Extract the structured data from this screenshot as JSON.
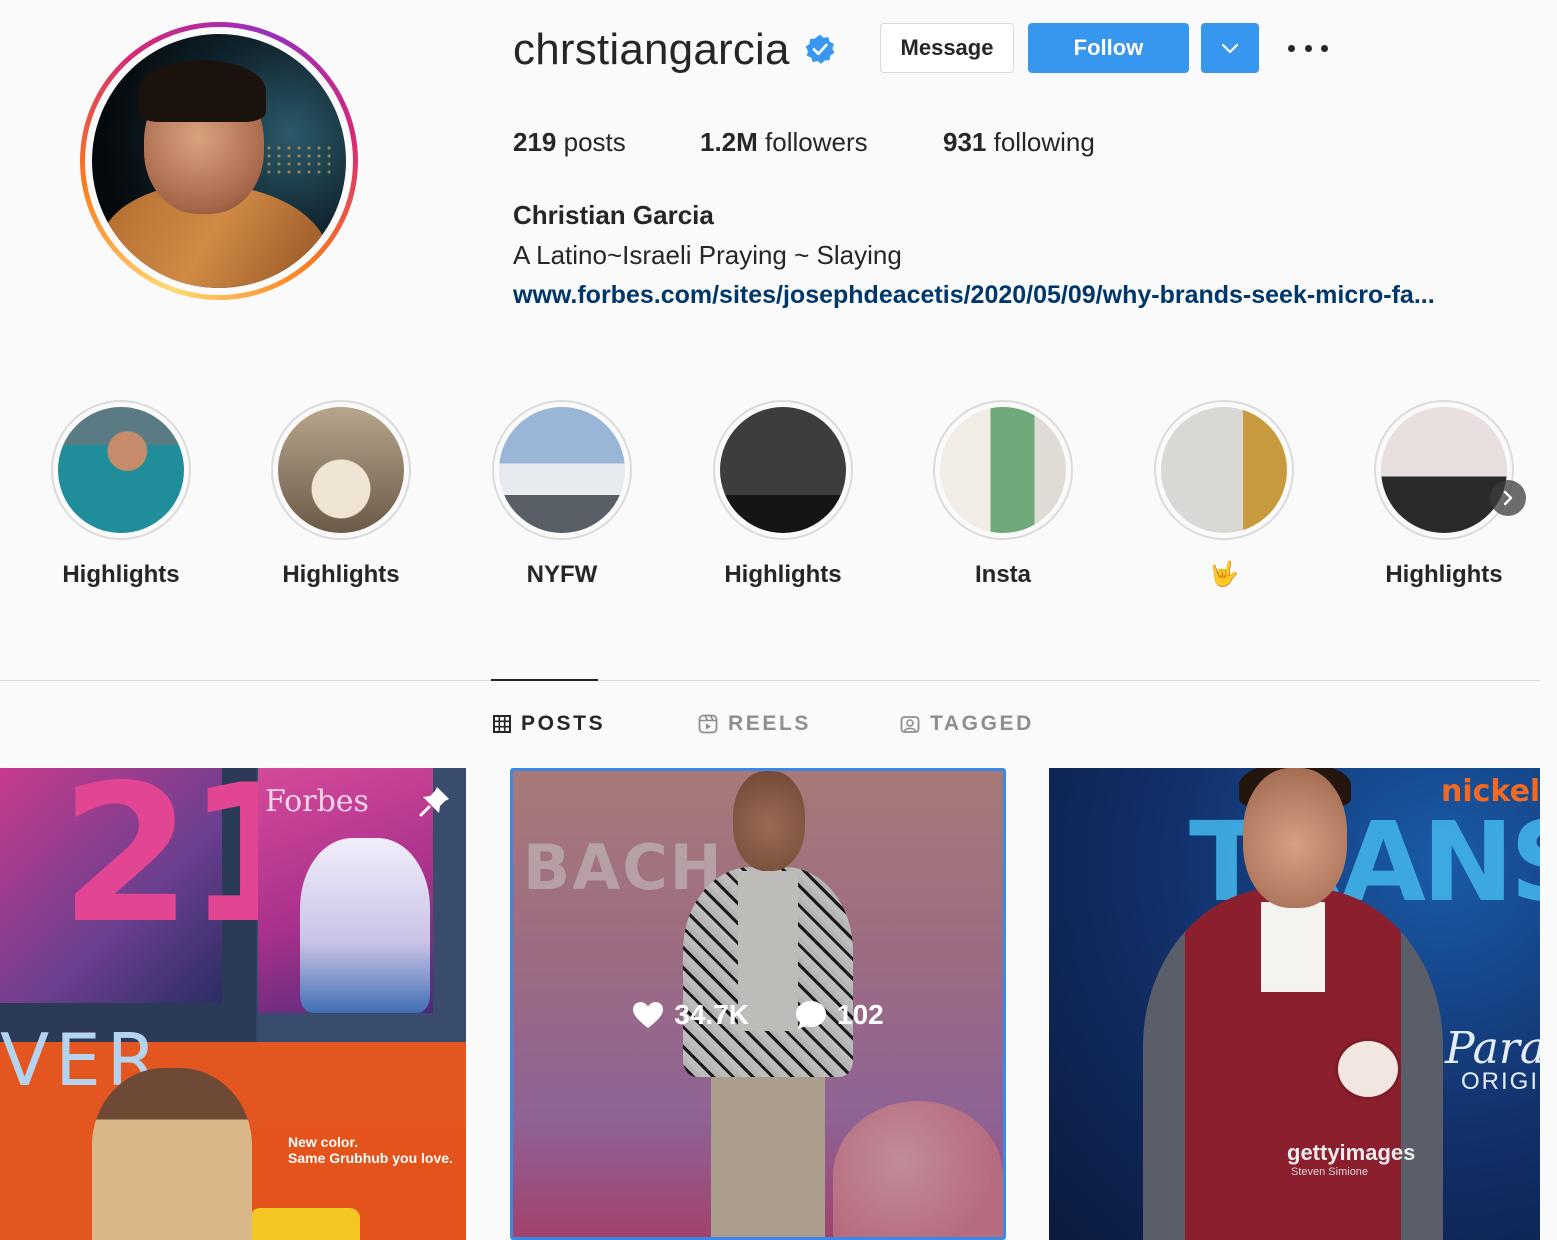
{
  "profile": {
    "username": "chrstiangarcia",
    "verified": true,
    "message_label": "Message",
    "follow_label": "Follow",
    "full_name": "Christian Garcia",
    "bio": "A Latino~Israeli Praying ~ Slaying",
    "link": "www.forbes.com/sites/josephdeacetis/2020/05/09/why-brands-seek-micro-fa..."
  },
  "stats": {
    "posts_count": "219",
    "posts_label": "posts",
    "followers_count": "1.2M",
    "followers_label": "followers",
    "following_count": "931",
    "following_label": "following"
  },
  "highlights": [
    {
      "label": "Highlights"
    },
    {
      "label": "Highlights"
    },
    {
      "label": "NYFW"
    },
    {
      "label": "Highlights"
    },
    {
      "label": "Insta"
    },
    {
      "label": "🤟"
    },
    {
      "label": "Highlights"
    }
  ],
  "tabs": [
    {
      "label": "POSTS",
      "icon": "grid-icon",
      "active": true
    },
    {
      "label": "REELS",
      "icon": "reels-icon",
      "active": false
    },
    {
      "label": "TAGGED",
      "icon": "tagged-icon",
      "active": false
    }
  ],
  "posts": [
    {
      "pinned": true,
      "text": {
        "forbes": "Forbes",
        "bus": "New color.\nSame Grubhub you love."
      }
    },
    {
      "hovered": true,
      "likes": "34.7K",
      "comments": "102",
      "text": {
        "backdrop": "BACH  R"
      }
    },
    {
      "text": {
        "brand": "nickel",
        "title": "TRANSF",
        "paramount": "Param",
        "original": "ORIGI",
        "watermark": "gettyimages",
        "credit": "Steven Simione"
      }
    }
  ],
  "colors": {
    "accent": "#3797ef",
    "link": "#00376b",
    "text": "#262626",
    "muted": "#8e8e8e",
    "background": "#fafafa"
  }
}
